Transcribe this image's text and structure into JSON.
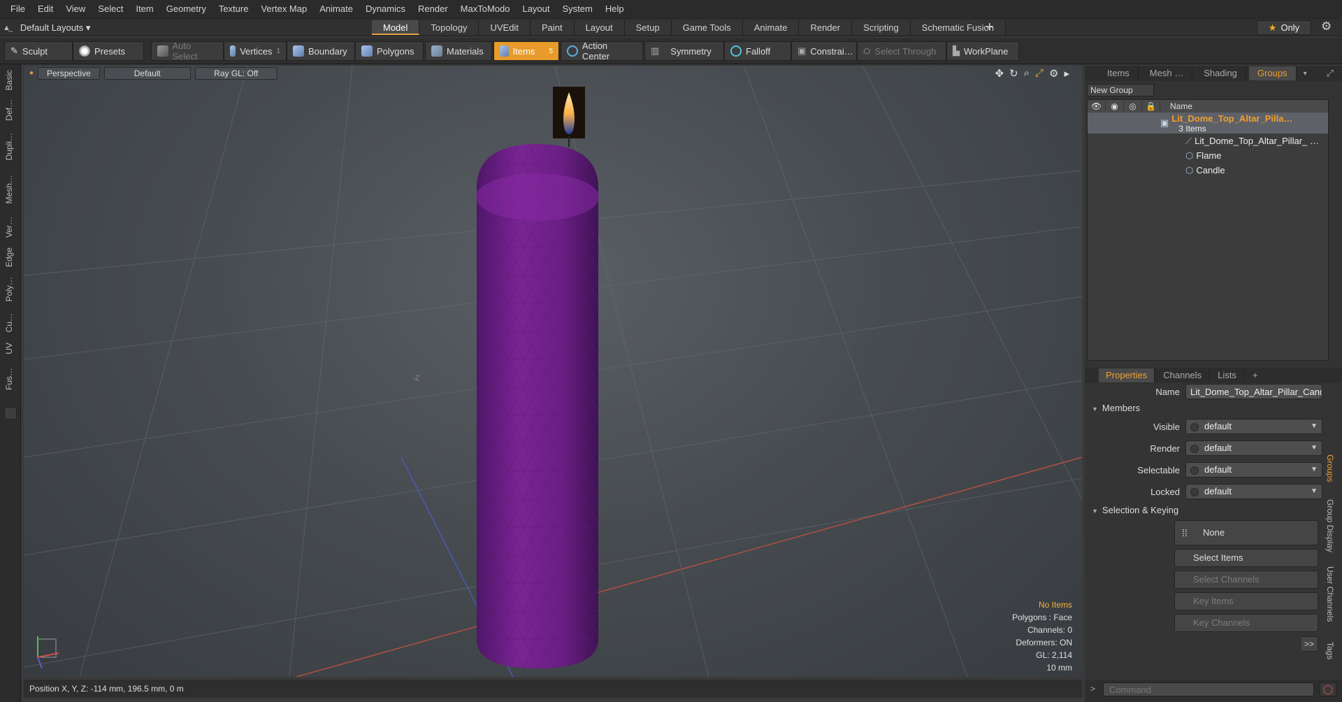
{
  "menu": [
    "File",
    "Edit",
    "View",
    "Select",
    "Item",
    "Geometry",
    "Texture",
    "Vertex Map",
    "Animate",
    "Dynamics",
    "Render",
    "MaxToModo",
    "Layout",
    "System",
    "Help"
  ],
  "layouts": {
    "label": "Default Layouts",
    "arrow": "▾"
  },
  "mode_tabs": [
    {
      "label": "Model",
      "active": true
    },
    {
      "label": "Topology"
    },
    {
      "label": "UVEdit"
    },
    {
      "label": "Paint"
    },
    {
      "label": "Layout"
    },
    {
      "label": "Setup"
    },
    {
      "label": "Game Tools"
    },
    {
      "label": "Animate"
    },
    {
      "label": "Render"
    },
    {
      "label": "Scripting"
    },
    {
      "label": "Schematic Fusion"
    }
  ],
  "only_label": "Only",
  "toolbar": {
    "sculpt": "Sculpt",
    "presets": "Presets",
    "auto_select": "Auto Select",
    "vertices": "Vertices",
    "vertices_count": "1",
    "boundary": "Boundary",
    "polygons": "Polygons",
    "materials": "Materials",
    "items": "Items",
    "items_count": "5",
    "action_center": "Action Center",
    "symmetry": "Symmetry",
    "falloff": "Falloff",
    "constrain": "Constrai…",
    "select_through": "Select Through",
    "workplane": "WorkPlane"
  },
  "left_tabs": [
    "Basic",
    "Def…",
    "Dupli…",
    "Mesh…",
    "Ver…",
    "Edge",
    "Poly…",
    "Cu…",
    "UV",
    "Fus…"
  ],
  "viewport": {
    "view": "Perspective",
    "shading": "Default",
    "raygl": "Ray GL: Off",
    "info": [
      "No Items",
      "Polygons : Face",
      "Channels: 0",
      "Deformers: ON",
      "GL: 2,114",
      "10 mm"
    ],
    "axis_label": "-Z"
  },
  "status": {
    "position": "Position X, Y, Z:  -114 mm, 196.5 mm, 0 m"
  },
  "right_tabs": [
    "Items",
    "Mesh …",
    "Shading",
    "Groups"
  ],
  "new_group": "New Group",
  "tree": {
    "name_header": "Name",
    "group_name": "Lit_Dome_Top_Altar_Pilla…",
    "group_count": "3 Items",
    "children": [
      "Lit_Dome_Top_Altar_Pillar_ …",
      "Flame",
      "Candle"
    ]
  },
  "props_tabs": [
    "Properties",
    "Channels",
    "Lists",
    "+"
  ],
  "props": {
    "name_label": "Name",
    "name_value": "Lit_Dome_Top_Altar_Pillar_Candle",
    "members": "Members",
    "visible_label": "Visible",
    "render_label": "Render",
    "selectable_label": "Selectable",
    "locked_label": "Locked",
    "default": "default",
    "sel_keying": "Selection & Keying",
    "none": "None",
    "select_items": "Select Items",
    "select_channels": "Select Channels",
    "key_items": "Key Items",
    "key_channels": "Key Channels",
    "more": ">>"
  },
  "side_vtabs": [
    "Groups",
    "Group Display",
    "User Channels",
    "Tags"
  ],
  "command_placeholder": "Command"
}
